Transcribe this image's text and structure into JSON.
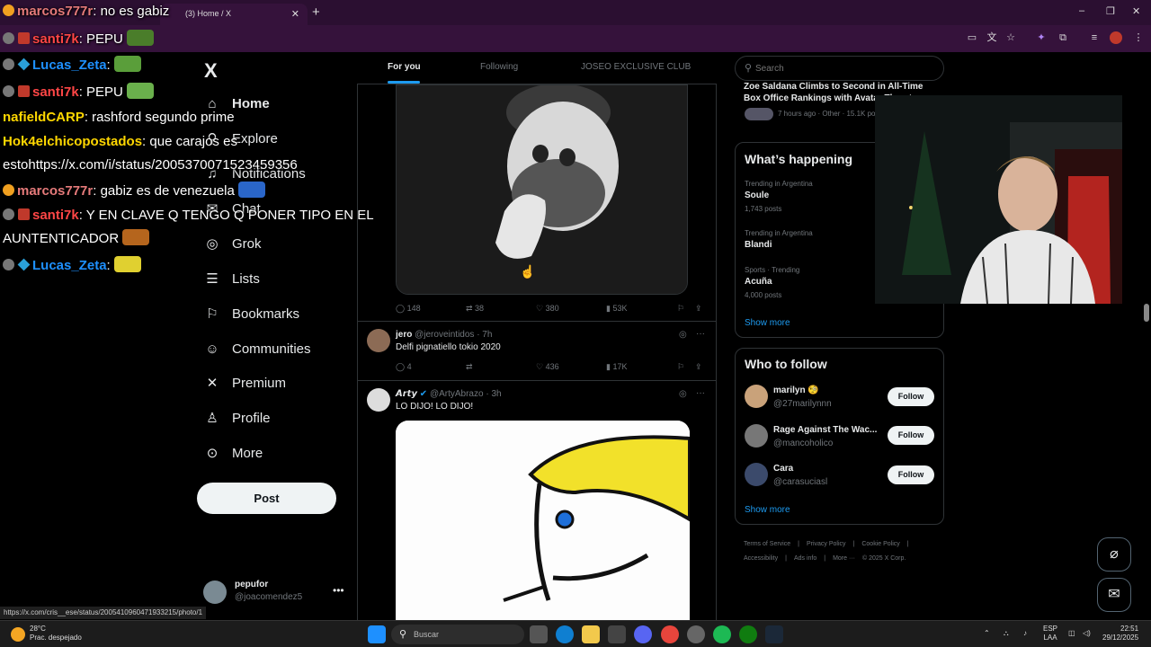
{
  "browser": {
    "tabs": [
      {
        "label": "(3) Home / X"
      }
    ],
    "new_tab_symbol": "+",
    "window_controls": [
      "–",
      "❐",
      "✕"
    ]
  },
  "chat": [
    {
      "user": "marcos777r",
      "text": ": no es gabiz",
      "user_color": "#e57a7a",
      "badge": "orange"
    },
    {
      "user": "santi7k",
      "text": ": PEPU",
      "user_color": "#ff4646",
      "badge": "red"
    },
    {
      "user": "Lucas_Zeta",
      "text": ":",
      "user_color": "#1e90ff",
      "badge": "blue"
    },
    {
      "user": "santi7k",
      "text": ": PEPU",
      "user_color": "#ff4646",
      "badge": "red"
    },
    {
      "user": "nafieldCARP",
      "text": ": rashford segundo prime",
      "user_color": "#ffd700",
      "badge": ""
    },
    {
      "user": "Hok4elchicopostados",
      "text": ": que carajos es",
      "user_color": "#ffd700",
      "badge": ""
    },
    {
      "user": "",
      "text": "estohttps://x.com/i/status/2005370071523459356",
      "user_color": "#fff",
      "badge": ""
    },
    {
      "user": "marcos777r",
      "text": ": gabiz es de venezuela",
      "user_color": "#e57a7a",
      "badge": "orange"
    },
    {
      "user": "santi7k",
      "text": ": Y EN CLAVE Q TENGO Q PONER TIPO EN EL",
      "user_color": "#ff4646",
      "badge": "red"
    },
    {
      "user": "",
      "text": "AUNTENTICADOR",
      "user_color": "#fff",
      "badge": ""
    },
    {
      "user": "Lucas_Zeta",
      "text": ":",
      "user_color": "#1e90ff",
      "badge": "blue"
    }
  ],
  "nav": {
    "logo": "X",
    "items": [
      {
        "label": "Home",
        "icon": "home-icon",
        "glyph": "⌂"
      },
      {
        "label": "Explore",
        "icon": "search-icon",
        "glyph": "⚲"
      },
      {
        "label": "Notifications",
        "icon": "bell-icon",
        "glyph": "♫"
      },
      {
        "label": "Chat",
        "icon": "mail-icon",
        "glyph": "✉"
      },
      {
        "label": "Grok",
        "icon": "grok-icon",
        "glyph": "◎"
      },
      {
        "label": "Lists",
        "icon": "list-icon",
        "glyph": "☰"
      },
      {
        "label": "Bookmarks",
        "icon": "bookmark-icon",
        "glyph": "⚐"
      },
      {
        "label": "Communities",
        "icon": "people-icon",
        "glyph": "☺"
      },
      {
        "label": "Premium",
        "icon": "x-icon",
        "glyph": "✕"
      },
      {
        "label": "Profile",
        "icon": "person-icon",
        "glyph": "♙"
      },
      {
        "label": "More",
        "icon": "more-icon",
        "glyph": "⊙"
      }
    ],
    "post_label": "Post",
    "account": {
      "name": "pepufor",
      "handle": "@joacomendez5",
      "menu": "•••"
    }
  },
  "feed": {
    "tabs": [
      "For you",
      "Following",
      "JOSEO EXCLUSIVE CLUB"
    ],
    "post1_actions": {
      "replies": "148",
      "reposts": "38",
      "likes": "380",
      "views": "53K"
    },
    "post2": {
      "name": "jero",
      "handle": "@jeroveintidos · 7h",
      "text": "Delfi pignatiello tokio 2020",
      "replies": "4",
      "reposts": "",
      "likes": "436",
      "views": "17K"
    },
    "post3": {
      "name": "𝘼𝙧𝙩𝙮",
      "handle": "@ArtyAbrazo · 3h",
      "text": "LO DIJO! LO DIJO!"
    }
  },
  "right": {
    "search_placeholder": "Search",
    "news": {
      "title": "Zoe Saldana Climbs to Second in All-Time Box Office Rankings with Avatar Threat",
      "meta": "7 hours ago · Other · 15.1K posts"
    },
    "whats_happening": {
      "title": "What’s happening",
      "trends": [
        {
          "meta": "Trending in Argentina",
          "name": "Soule",
          "count": "1,743 posts"
        },
        {
          "meta": "Trending in Argentina",
          "name": "Blandi",
          "count": ""
        },
        {
          "meta": "Sports · Trending",
          "name": "Acuña",
          "count": "4,000 posts"
        }
      ],
      "show_more": "Show more"
    },
    "who_to_follow": {
      "title": "Who to follow",
      "users": [
        {
          "name": "marilyn 🧐",
          "handle": "@27marilynnn",
          "button": "Follow"
        },
        {
          "name": "Rage Against The Wac...",
          "handle": "@mancoholico",
          "button": "Follow"
        },
        {
          "name": "Cara",
          "handle": "@carasuciasl",
          "button": "Follow"
        }
      ],
      "show_more": "Show more"
    },
    "footer": [
      "Terms of Service",
      "|",
      "Privacy Policy",
      "|",
      "Cookie Policy",
      "|",
      "Accessibility",
      "|",
      "Ads info",
      "|",
      "More ···",
      "© 2025 X Corp."
    ]
  },
  "status_url": "https://x.com/cris__ese/status/2005410960471933215/photo/1",
  "taskbar": {
    "temp": "28°C",
    "weather": "Prac. despejado",
    "search_label": "Buscar",
    "lang_line1": "ESP",
    "lang_line2": "LAA",
    "time": "22:51",
    "date": "29/12/2025"
  },
  "colors": {
    "accent": "#1d9bf0",
    "browser": "#35123b"
  }
}
